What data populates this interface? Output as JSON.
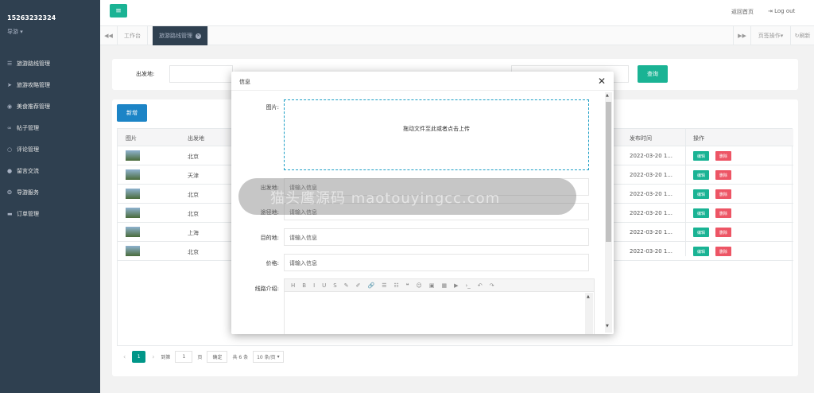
{
  "sidebar": {
    "user": "15263232324",
    "role": "导游",
    "items": [
      {
        "label": "旅游路线管理",
        "icon": "list-icon"
      },
      {
        "label": "旅游攻略管理",
        "icon": "send-icon"
      },
      {
        "label": "美食推荐管理",
        "icon": "food-icon"
      },
      {
        "label": "帖子管理",
        "icon": "chat-icon"
      },
      {
        "label": "评论管理",
        "icon": "comment-icon"
      },
      {
        "label": "留言交流",
        "icon": "message-icon"
      },
      {
        "label": "导游服务",
        "icon": "service-icon"
      },
      {
        "label": "订单管理",
        "icon": "order-icon"
      }
    ]
  },
  "header": {
    "back_home": "返回首页",
    "logout": "Log out"
  },
  "tabs": {
    "home": "工作台",
    "active": "旅游路线管理",
    "page_ops": "页签操作",
    "refresh": "刷新"
  },
  "search": {
    "from_label": "出发地:",
    "query_button": "查询"
  },
  "table": {
    "add_button": "新增",
    "columns": {
      "image": "图片",
      "from": "出发地",
      "publish_time": "发布时间",
      "ops": "操作"
    },
    "rows": [
      {
        "from": "北京",
        "time": "2022-03-20 1..."
      },
      {
        "from": "天津",
        "time": "2022-03-20 1..."
      },
      {
        "from": "北京",
        "time": "2022-03-20 1..."
      },
      {
        "from": "北京",
        "time": "2022-03-20 1..."
      },
      {
        "from": "上海",
        "time": "2022-03-20 1..."
      },
      {
        "from": "北京",
        "time": "2022-03-20 1..."
      }
    ],
    "edit_label": "编辑",
    "delete_label": "删除"
  },
  "pager": {
    "current": "1",
    "goto_label": "到第",
    "goto_value": "1",
    "page_unit": "页",
    "confirm": "确定",
    "total": "共 6 条",
    "page_size": "10 条/页"
  },
  "modal": {
    "title": "信息",
    "image_label": "图片:",
    "upload_text": "拖动文件至此或者点击上传",
    "from_label": "出发地:",
    "via_label": "途径地:",
    "dest_label": "目的地:",
    "price_label": "价格:",
    "intro_label": "线路介绍:",
    "placeholder": "请输入信息"
  },
  "editor_tools": [
    "H",
    "B",
    "I",
    "U",
    "S",
    "✎",
    "✐",
    "🔗",
    "☰",
    "☷",
    "❝",
    "☺",
    "▣",
    "▦",
    "▶",
    "›_",
    "↶",
    "↷"
  ],
  "watermark": "猫头鹰源码 maotouyingcc.com"
}
